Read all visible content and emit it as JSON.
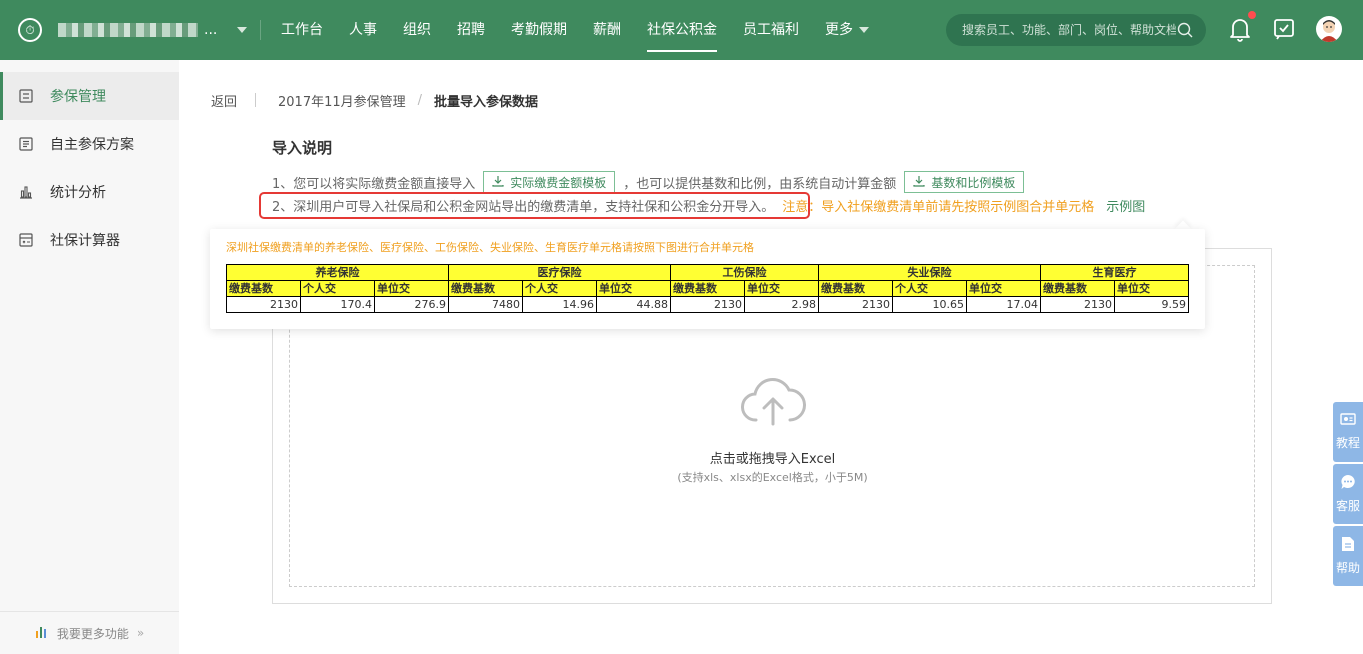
{
  "topbar": {
    "company_suffix": "...",
    "nav": [
      "工作台",
      "人事",
      "组织",
      "招聘",
      "考勤假期",
      "薪酬",
      "社保公积金",
      "员工福利"
    ],
    "more_label": "更多",
    "search_placeholder": "搜索员工、功能、部门、岗位、帮助文档",
    "brand_color": "#3f8a5e"
  },
  "sidebar": {
    "items": [
      {
        "label": "参保管理",
        "icon": "insurance-doc-icon"
      },
      {
        "label": "自主参保方案",
        "icon": "plan-list-icon"
      },
      {
        "label": "统计分析",
        "icon": "bar-chart-icon"
      },
      {
        "label": "社保计算器",
        "icon": "calculator-icon"
      }
    ],
    "footer": "我要更多功能"
  },
  "breadcrumb": {
    "back": "返回",
    "parent": "2017年11月参保管理",
    "current": "批量导入参保数据"
  },
  "instructions": {
    "title": "导入说明",
    "line1_prefix": "1、您可以将实际缴费金额直接导入",
    "btn_actual": "实际缴费金额模板",
    "line1_mid": "，也可以提供基数和比例，由系统自动计算金额",
    "btn_ratio": "基数和比例模板",
    "line2": "2、深圳用户可导入社保局和公积金网站导出的缴费清单，支持社保和公积金分开导入。",
    "note": "注意：导入社保缴费清单前请先按照示例图合并单元格",
    "example_link": "示例图"
  },
  "popover": {
    "title": "深圳社保缴费清单的养老保险、医疗保险、工伤保险、失业保险、生育医疗单元格请按照下图进行合并单元格",
    "groups": [
      "养老保险",
      "医疗保险",
      "工伤保险",
      "失业保险",
      "生育医疗"
    ],
    "subheaders": [
      "缴费基数",
      "个人交",
      "单位交",
      "缴费基数",
      "个人交",
      "单位交",
      "缴费基数",
      "单位交",
      "缴费基数",
      "个人交",
      "单位交",
      "缴费基数",
      "单位交"
    ],
    "row": [
      "2130",
      "170.4",
      "276.9",
      "7480",
      "14.96",
      "44.88",
      "2130",
      "2.98",
      "2130",
      "10.65",
      "17.04",
      "2130",
      "9.59"
    ]
  },
  "upload": {
    "main": "点击或拖拽导入Excel",
    "sub": "(支持xls、xlsx的Excel格式，小于5M)"
  },
  "floating": {
    "tutorial": "教程",
    "service": "客服",
    "help": "帮助"
  }
}
